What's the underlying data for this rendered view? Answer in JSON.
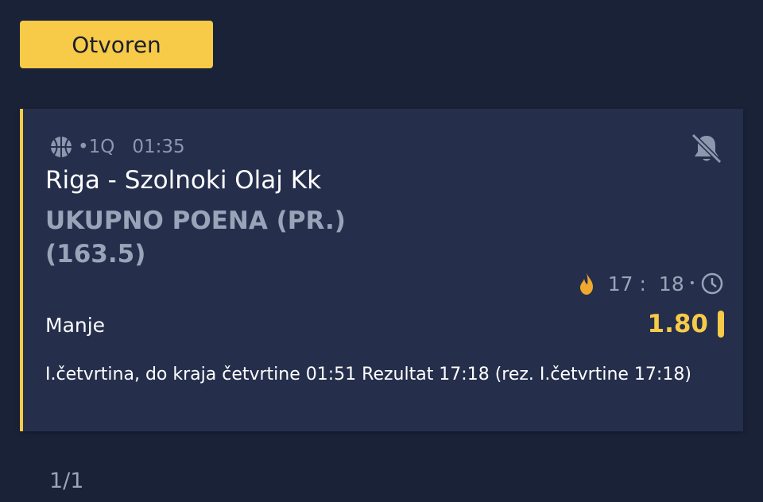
{
  "status_label": "Otvoren",
  "bet": {
    "sport_icon": "basketball-icon",
    "period": "•1Q",
    "time": "01:35",
    "mute_icon": "bell-off-icon",
    "match": "Riga - Szolnoki Olaj Kk",
    "market": "UKUPNO POENA (PR.)",
    "line": "(163.5)",
    "score_home": "17 :",
    "score_away": "18",
    "separator": "•",
    "live_icon": "flame-icon",
    "clock_icon": "clock-icon",
    "selection": "Manje",
    "odds": "1.80",
    "description": "I.četvrtina, do kraja četvrtine 01:51 Rezultat 17:18 (rez. I.četvrtine 17:18)"
  },
  "pagination": "1/1",
  "colors": {
    "background": "#1a2238",
    "card": "#252f4c",
    "accent": "#f7ca48",
    "muted": "#9ba3b8"
  }
}
